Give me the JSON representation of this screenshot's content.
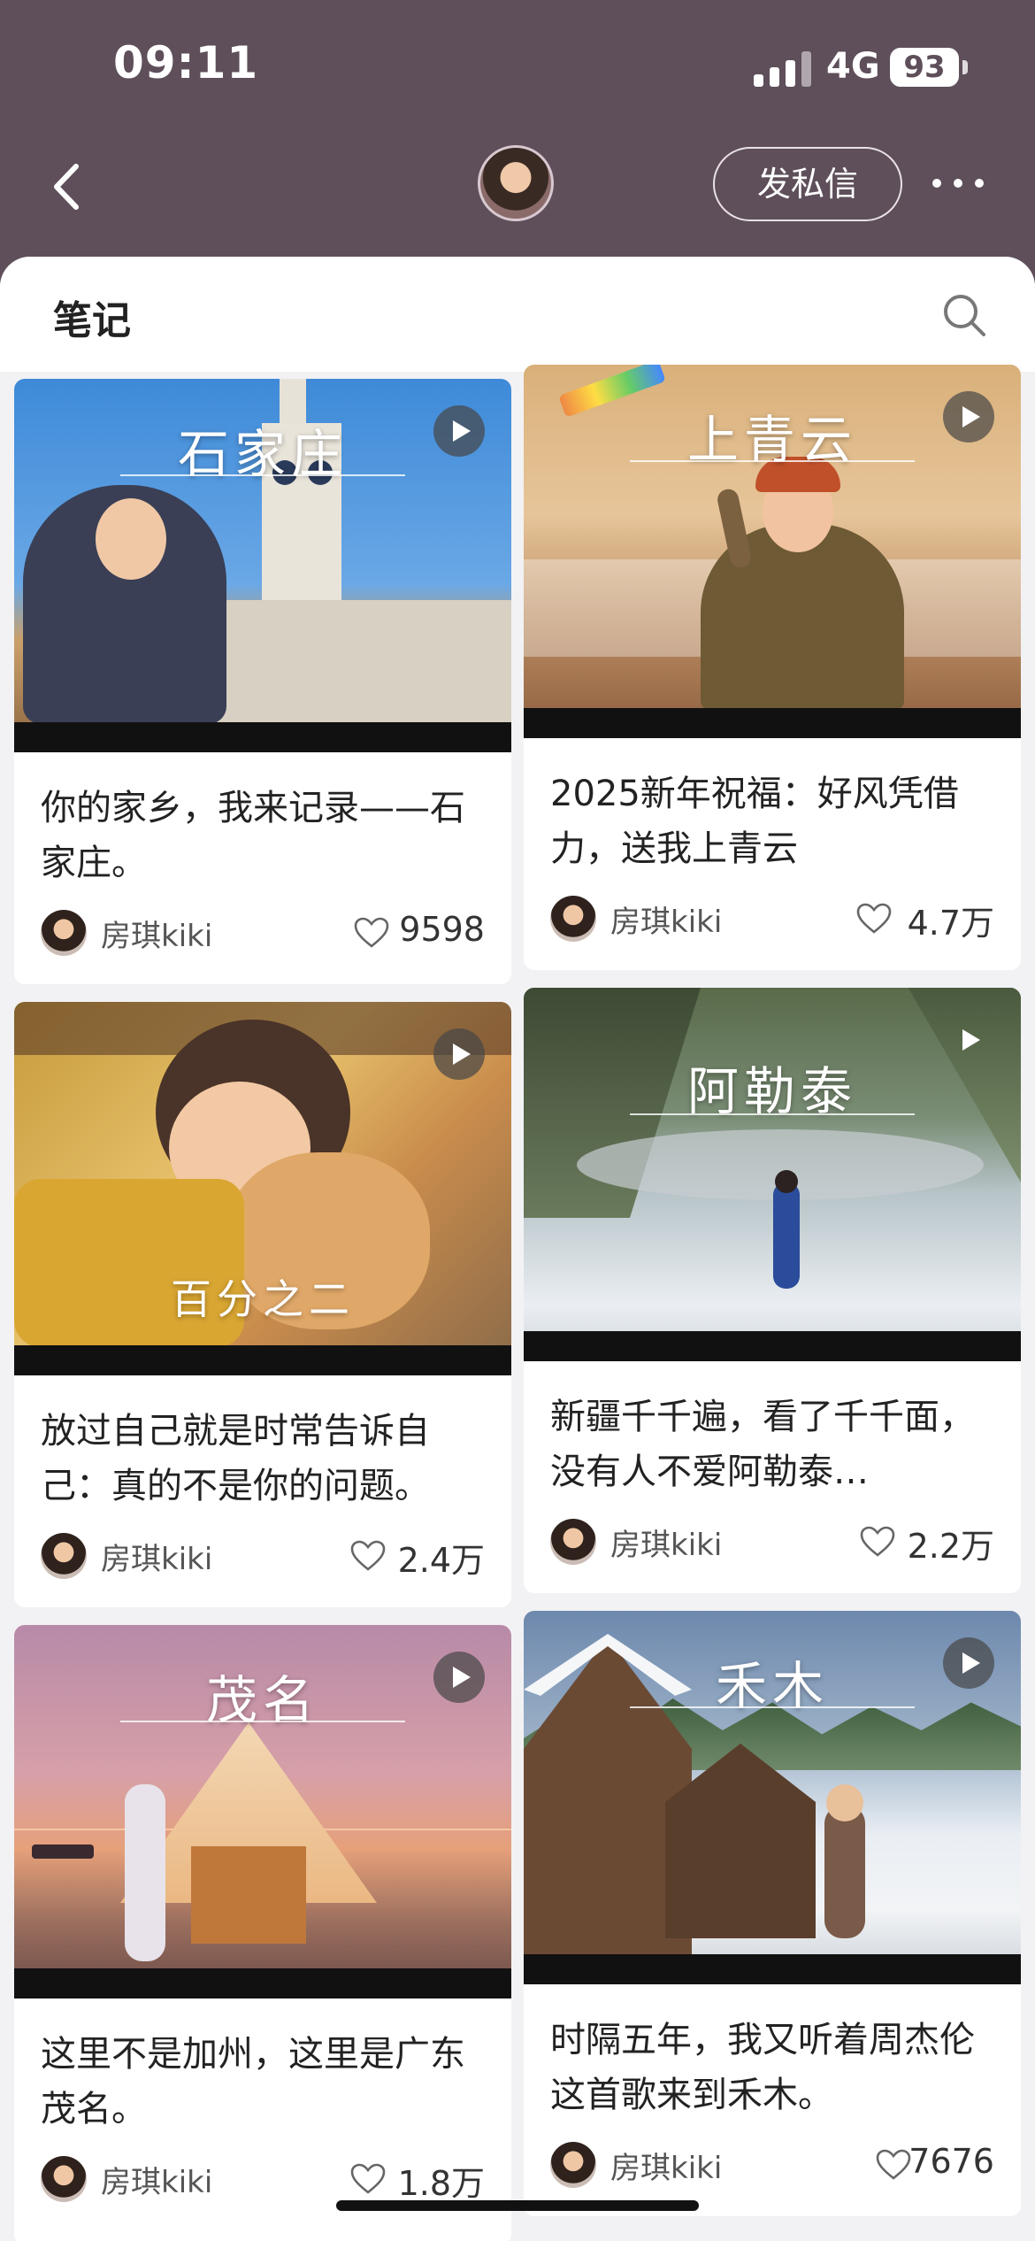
{
  "status_bar": {
    "time": "09:11",
    "network": "4G",
    "battery": "93"
  },
  "nav": {
    "message_button": "发私信"
  },
  "sheet": {
    "title": "笔记"
  },
  "author": "房琪kiki",
  "cards": [
    {
      "video_title": "石家庄",
      "title": "你的家乡，我来记录——石家庄。",
      "likes": "9598"
    },
    {
      "video_title": "上青云",
      "title": "2025新年祝福：好风凭借力，送我上青云",
      "likes": "4.7万"
    },
    {
      "video_title": "百分之二",
      "title": "放过自己就是时常告诉自己：真的不是你的问题。",
      "likes": "2.4万"
    },
    {
      "video_title": "阿勒泰",
      "title": "新疆千千遍，看了千千面，没有人不爱阿勒泰…",
      "likes": "2.2万"
    },
    {
      "video_title": "茂名",
      "title": "这里不是加州，这里是广东茂名。",
      "likes": "1.8万"
    },
    {
      "video_title": "禾木",
      "title": "时隔五年，我又听着周杰伦这首歌来到禾木。",
      "likes": "7676"
    }
  ]
}
